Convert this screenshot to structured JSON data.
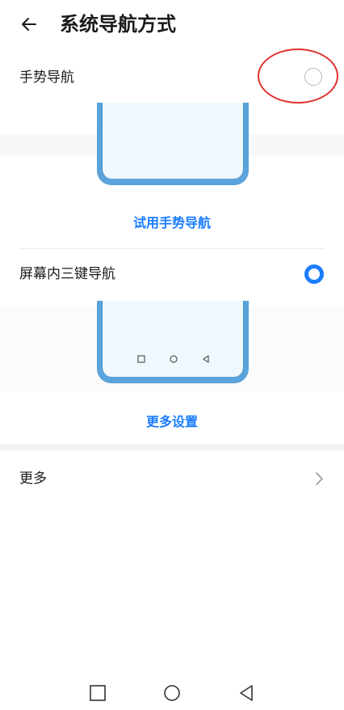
{
  "header": {
    "title": "系统导航方式"
  },
  "options": [
    {
      "label": "手势导航",
      "selected": false,
      "link": "试用手势导航"
    },
    {
      "label": "屏幕内三键导航",
      "selected": true,
      "link": "更多设置"
    }
  ],
  "more": {
    "label": "更多"
  },
  "colors": {
    "accent": "#1a7dff",
    "phone": "#5aa3db",
    "annotation": "#e0322f"
  },
  "icons": {
    "back": "arrow-left-icon",
    "more": "chevron-right-icon",
    "nav": [
      "square-icon",
      "circle-icon",
      "triangle-left-icon"
    ]
  }
}
